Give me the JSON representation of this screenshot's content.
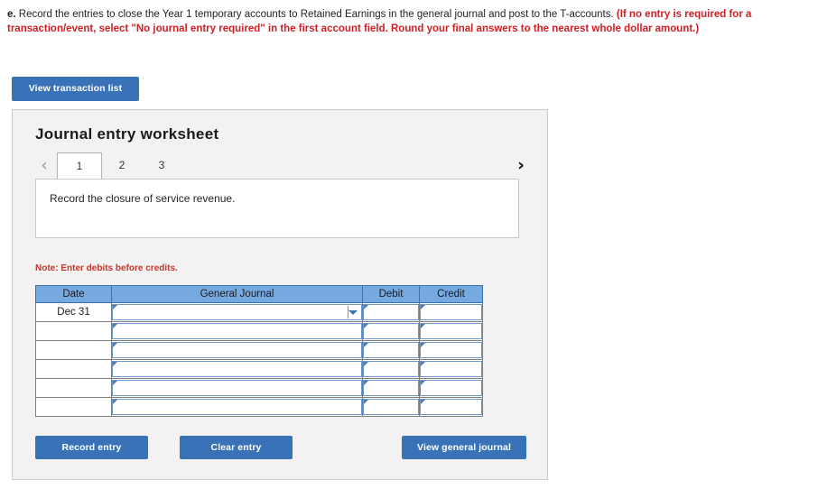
{
  "prompt": {
    "lead": "e.",
    "normal_text": " Record the entries to close the Year 1 temporary accounts to Retained Earnings in the general journal and post to the T-accounts. ",
    "red_text": "(If no entry is required for a transaction/event, select \"No journal entry required\" in the first account field. Round your final answers to the nearest whole dollar amount.)"
  },
  "toolbar": {
    "view_transaction_list_label": "View transaction list"
  },
  "worksheet": {
    "title": "Journal entry worksheet",
    "prev_icon": "‹",
    "next_icon": "›",
    "tabs": [
      {
        "label": "1",
        "active": true
      },
      {
        "label": "2",
        "active": false
      },
      {
        "label": "3",
        "active": false
      }
    ],
    "description": "Record the closure of service revenue.",
    "note": "Note: Enter debits before credits."
  },
  "journal_table": {
    "headers": [
      "Date",
      "General Journal",
      "Debit",
      "Credit"
    ],
    "rows": [
      {
        "date": "Dec 31",
        "general_journal": "",
        "debit": "",
        "credit": "",
        "has_dropdown": true
      },
      {
        "date": "",
        "general_journal": "",
        "debit": "",
        "credit": "",
        "has_dropdown": false
      },
      {
        "date": "",
        "general_journal": "",
        "debit": "",
        "credit": "",
        "has_dropdown": false
      },
      {
        "date": "",
        "general_journal": "",
        "debit": "",
        "credit": "",
        "has_dropdown": false
      },
      {
        "date": "",
        "general_journal": "",
        "debit": "",
        "credit": "",
        "has_dropdown": false
      },
      {
        "date": "",
        "general_journal": "",
        "debit": "",
        "credit": "",
        "has_dropdown": false
      }
    ]
  },
  "actions": {
    "record_entry_label": "Record entry",
    "clear_entry_label": "Clear entry",
    "view_general_journal_label": "View general journal"
  },
  "colors": {
    "button_blue": "#3a72b8",
    "table_header_blue": "#76a9e0",
    "alert_red": "#cc2127",
    "note_red": "#c0392b",
    "panel_gray": "#f2f2f2"
  }
}
